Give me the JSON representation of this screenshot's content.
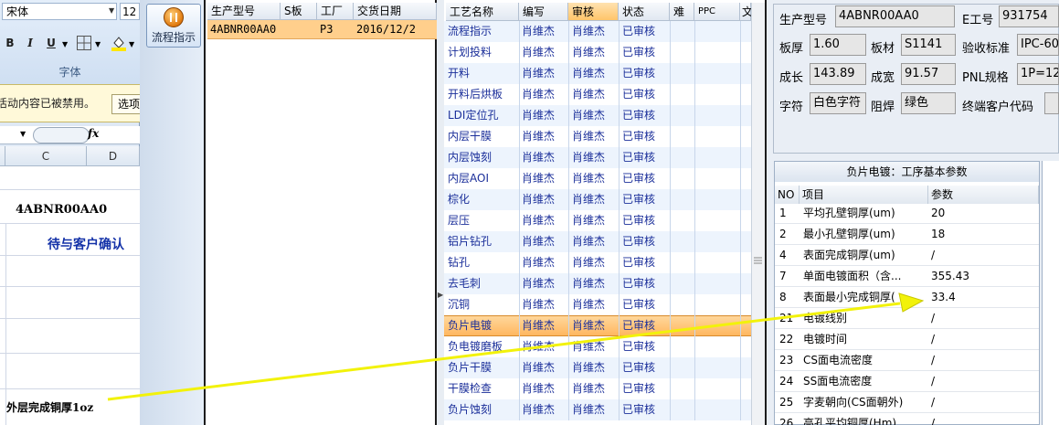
{
  "excel": {
    "font_name": "宋体",
    "font_size": "12",
    "format_buttons": [
      "B",
      "I",
      "U"
    ],
    "group_label": "字体",
    "security_warning": "活动内容已被禁用。",
    "options_label": "选项",
    "fx_label": "fx",
    "col_headers": [
      "C",
      "D"
    ],
    "cell_part_code": "4ABNR00AA0",
    "cell_pending": "待与客户确认",
    "cell_outer": "外层完成铜厚1oz"
  },
  "flow_button": {
    "label": "流程指示"
  },
  "orders": {
    "headers": [
      "生产型号",
      "S板",
      "工厂",
      "交货日期"
    ],
    "rows": [
      {
        "part": "4ABNR00AA0",
        "s": "",
        "factory": "P3",
        "date": "2016/12/2"
      }
    ]
  },
  "process": {
    "headers": [
      "工艺名称",
      "编写",
      "审核",
      "状态",
      "难",
      "PPC",
      "文"
    ],
    "rows": [
      {
        "name": "流程指示",
        "author": "肖维杰",
        "reviewer": "肖维杰",
        "status": "已审核"
      },
      {
        "name": "计划投料",
        "author": "肖维杰",
        "reviewer": "肖维杰",
        "status": "已审核"
      },
      {
        "name": "开料",
        "author": "肖维杰",
        "reviewer": "肖维杰",
        "status": "已审核"
      },
      {
        "name": "开料后烘板",
        "author": "肖维杰",
        "reviewer": "肖维杰",
        "status": "已审核"
      },
      {
        "name": "LDI定位孔",
        "author": "肖维杰",
        "reviewer": "肖维杰",
        "status": "已审核"
      },
      {
        "name": "内层干膜",
        "author": "肖维杰",
        "reviewer": "肖维杰",
        "status": "已审核"
      },
      {
        "name": "内层蚀刻",
        "author": "肖维杰",
        "reviewer": "肖维杰",
        "status": "已审核"
      },
      {
        "name": "内层AOI",
        "author": "肖维杰",
        "reviewer": "肖维杰",
        "status": "已审核"
      },
      {
        "name": "棕化",
        "author": "肖维杰",
        "reviewer": "肖维杰",
        "status": "已审核"
      },
      {
        "name": "层压",
        "author": "肖维杰",
        "reviewer": "肖维杰",
        "status": "已审核"
      },
      {
        "name": "铝片钻孔",
        "author": "肖维杰",
        "reviewer": "肖维杰",
        "status": "已审核"
      },
      {
        "name": "钻孔",
        "author": "肖维杰",
        "reviewer": "肖维杰",
        "status": "已审核"
      },
      {
        "name": "去毛刺",
        "author": "肖维杰",
        "reviewer": "肖维杰",
        "status": "已审核"
      },
      {
        "name": "沉铜",
        "author": "肖维杰",
        "reviewer": "肖维杰",
        "status": "已审核"
      },
      {
        "name": "负片电镀",
        "author": "肖维杰",
        "reviewer": "肖维杰",
        "status": "已审核"
      },
      {
        "name": "负电镀磨板",
        "author": "肖维杰",
        "reviewer": "肖维杰",
        "status": "已审核"
      },
      {
        "name": "负片干膜",
        "author": "肖维杰",
        "reviewer": "肖维杰",
        "status": "已审核"
      },
      {
        "name": "干膜检查",
        "author": "肖维杰",
        "reviewer": "肖维杰",
        "status": "已审核"
      },
      {
        "name": "负片蚀刻",
        "author": "肖维杰",
        "reviewer": "肖维杰",
        "status": "已审核"
      }
    ],
    "selected_index": 14
  },
  "info": {
    "part_label": "生产型号",
    "part_value": "4ABNR00AA0",
    "eid_label": "E工号",
    "eid_value": "931754",
    "thick_label": "板厚",
    "thick_value": "1.60",
    "material_label": "板材",
    "material_value": "S1141",
    "accept_label": "验收标准",
    "accept_value": "IPC-60",
    "length_label": "成长",
    "length_value": "143.89",
    "width_label": "成宽",
    "width_value": "91.57",
    "pnl_label": "PNL规格",
    "pnl_value": "1P=12",
    "silk_label": "字符",
    "silk_value": "白色字符",
    "mask_label": "阻焊",
    "mask_value": "绿色",
    "customer_label": "终端客户代码",
    "customer_value": ""
  },
  "params": {
    "title": "负片电镀：工序基本参数",
    "headers": [
      "NO",
      "项目",
      "参数"
    ],
    "rows": [
      {
        "no": "1",
        "item": "平均孔壁铜厚(um)",
        "value": "20"
      },
      {
        "no": "2",
        "item": "最小孔壁铜厚(um)",
        "value": "18"
      },
      {
        "no": "4",
        "item": "表面完成铜厚(um)",
        "value": "/"
      },
      {
        "no": "7",
        "item": "单面电镀面积（含...",
        "value": "355.43"
      },
      {
        "no": "8",
        "item": "表面最小完成铜厚(",
        "value": "33.4"
      },
      {
        "no": "21",
        "item": "电镀线别",
        "value": "/"
      },
      {
        "no": "22",
        "item": "电镀时间",
        "value": "/"
      },
      {
        "no": "23",
        "item": "CS面电流密度",
        "value": "/"
      },
      {
        "no": "24",
        "item": "SS面电流密度",
        "value": "/"
      },
      {
        "no": "25",
        "item": "字麦朝向(CS面朝外)",
        "value": "/"
      },
      {
        "no": "26",
        "item": "高孔平均铜厚(Hm)",
        "value": "/"
      }
    ]
  },
  "colors": {
    "highlight": "#ffc56a",
    "link_text": "#1b2f9a",
    "annotation_arrow": "#f2f20a"
  }
}
